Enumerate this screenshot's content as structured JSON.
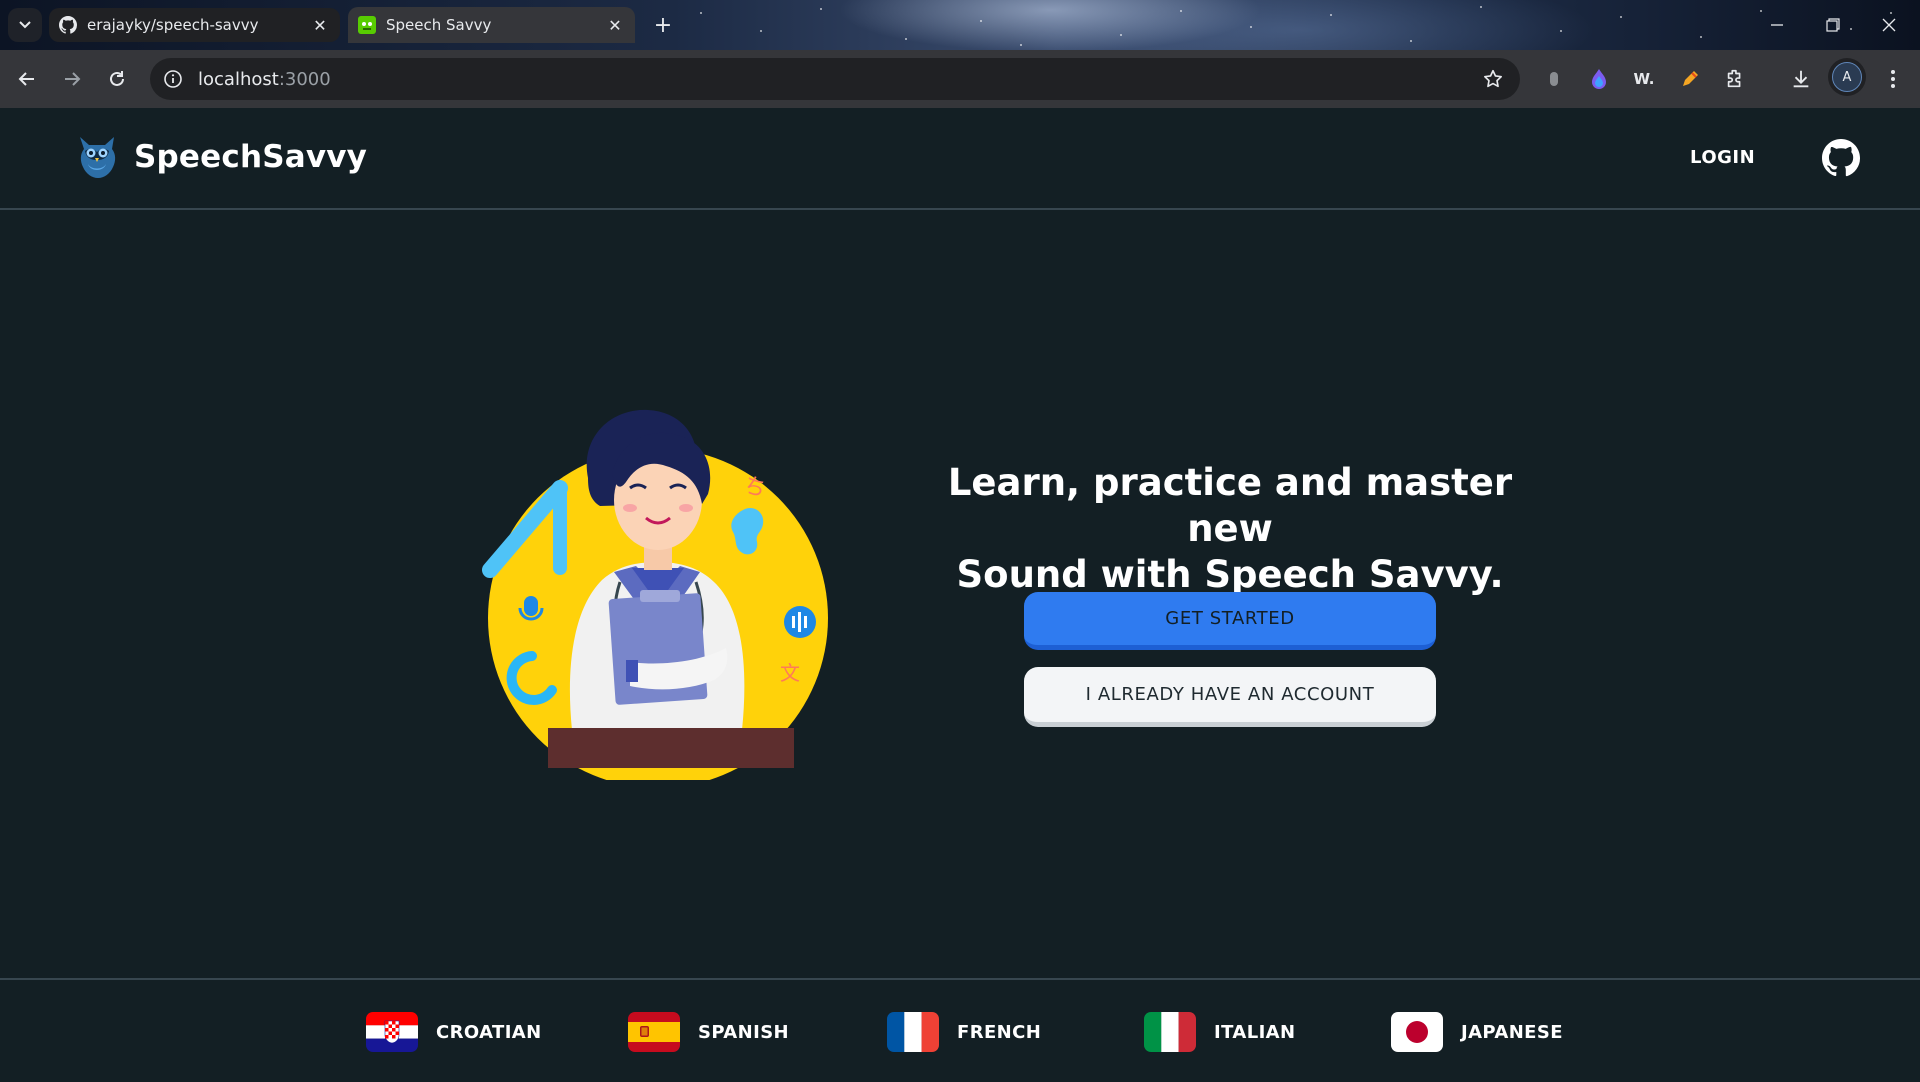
{
  "browser": {
    "tabs": [
      {
        "title": "erajayky/speech-savvy",
        "active": false
      },
      {
        "title": "Speech Savvy",
        "active": true
      }
    ],
    "url_host": "localhost",
    "url_port": ":3000",
    "extensions": [
      {
        "name": "extension-1-icon"
      },
      {
        "name": "extension-2-icon"
      },
      {
        "name": "extension-w-icon",
        "text": "W."
      },
      {
        "name": "extension-pencil-icon"
      },
      {
        "name": "extensions-puzzle-icon"
      }
    ],
    "profile_initial": "A"
  },
  "header": {
    "brand_name": "SpeechSavvy",
    "login_label": "LOGIN"
  },
  "hero": {
    "headline_line1": "Learn, practice and master new",
    "headline_line2": "Sound with Speech Savvy.",
    "primary_button": "GET STARTED",
    "secondary_button": "I ALREADY HAVE AN ACCOUNT"
  },
  "footer": {
    "languages": [
      {
        "label": "CROATIAN",
        "flag": "croatia-flag-icon"
      },
      {
        "label": "SPANISH",
        "flag": "spain-flag-icon"
      },
      {
        "label": "FRENCH",
        "flag": "france-flag-icon"
      },
      {
        "label": "ITALIAN",
        "flag": "italy-flag-icon"
      },
      {
        "label": "JAPANESE",
        "flag": "japan-flag-icon"
      }
    ]
  },
  "colors": {
    "page_background": "#131f24",
    "primary_button": "#2f7bf0",
    "divider": "#37464f"
  }
}
